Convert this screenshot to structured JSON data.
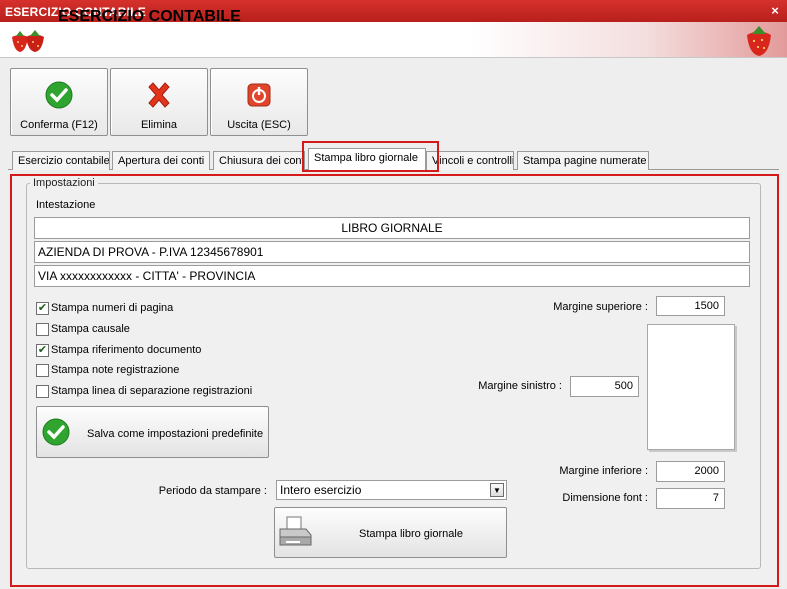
{
  "window": {
    "title": "ESERCIZIO CONTABILE",
    "close_glyph": "×"
  },
  "header": {
    "title": "ESERCIZIO CONTABILE",
    "icon": "strawberry-icon"
  },
  "toolbar": {
    "confirm_label": "Conferma (F12)",
    "delete_label": "Elimina",
    "exit_label": "Uscita (ESC)"
  },
  "tabs": [
    {
      "label": "Esercizio contabile"
    },
    {
      "label": "Apertura dei conti"
    },
    {
      "label": "Chiusura dei conti"
    },
    {
      "label": "Stampa libro giornale",
      "active": true
    },
    {
      "label": "Vincoli e controlli"
    },
    {
      "label": "Stampa pagine numerate"
    }
  ],
  "settings": {
    "group_label": "Impostazioni",
    "heading_label": "Intestazione",
    "heading_lines": [
      "LIBRO GIORNALE",
      "AZIENDA DI PROVA - P.IVA 12345678901",
      "VIA xxxxxxxxxxxx - CITTA' - PROVINCIA"
    ],
    "checkboxes": [
      {
        "label": "Stampa numeri di pagina",
        "checked": true
      },
      {
        "label": "Stampa causale",
        "checked": false
      },
      {
        "label": "Stampa riferimento documento",
        "checked": true
      },
      {
        "label": "Stampa note registrazione",
        "checked": false
      },
      {
        "label": "Stampa linea di separazione registrazioni",
        "checked": false
      }
    ],
    "check_glyph": "✔",
    "save_default_label": "Salva come impostazioni predefinite",
    "margins": {
      "top_label": "Margine superiore :",
      "top_value": "1500",
      "left_label": "Margine sinistro :",
      "left_value": "500",
      "bottom_label": "Margine inferiore :",
      "bottom_value": "2000",
      "font_label": "Dimensione font :",
      "font_value": "7"
    },
    "period_label": "Periodo da stampare :",
    "period_value": "Intero esercizio",
    "combo_arrow": "▼",
    "print_label": "Stampa libro giornale"
  },
  "colors": {
    "title_red": "#c4221e",
    "highlight_red": "#d41a1a",
    "check_green": "#2fa52f"
  }
}
